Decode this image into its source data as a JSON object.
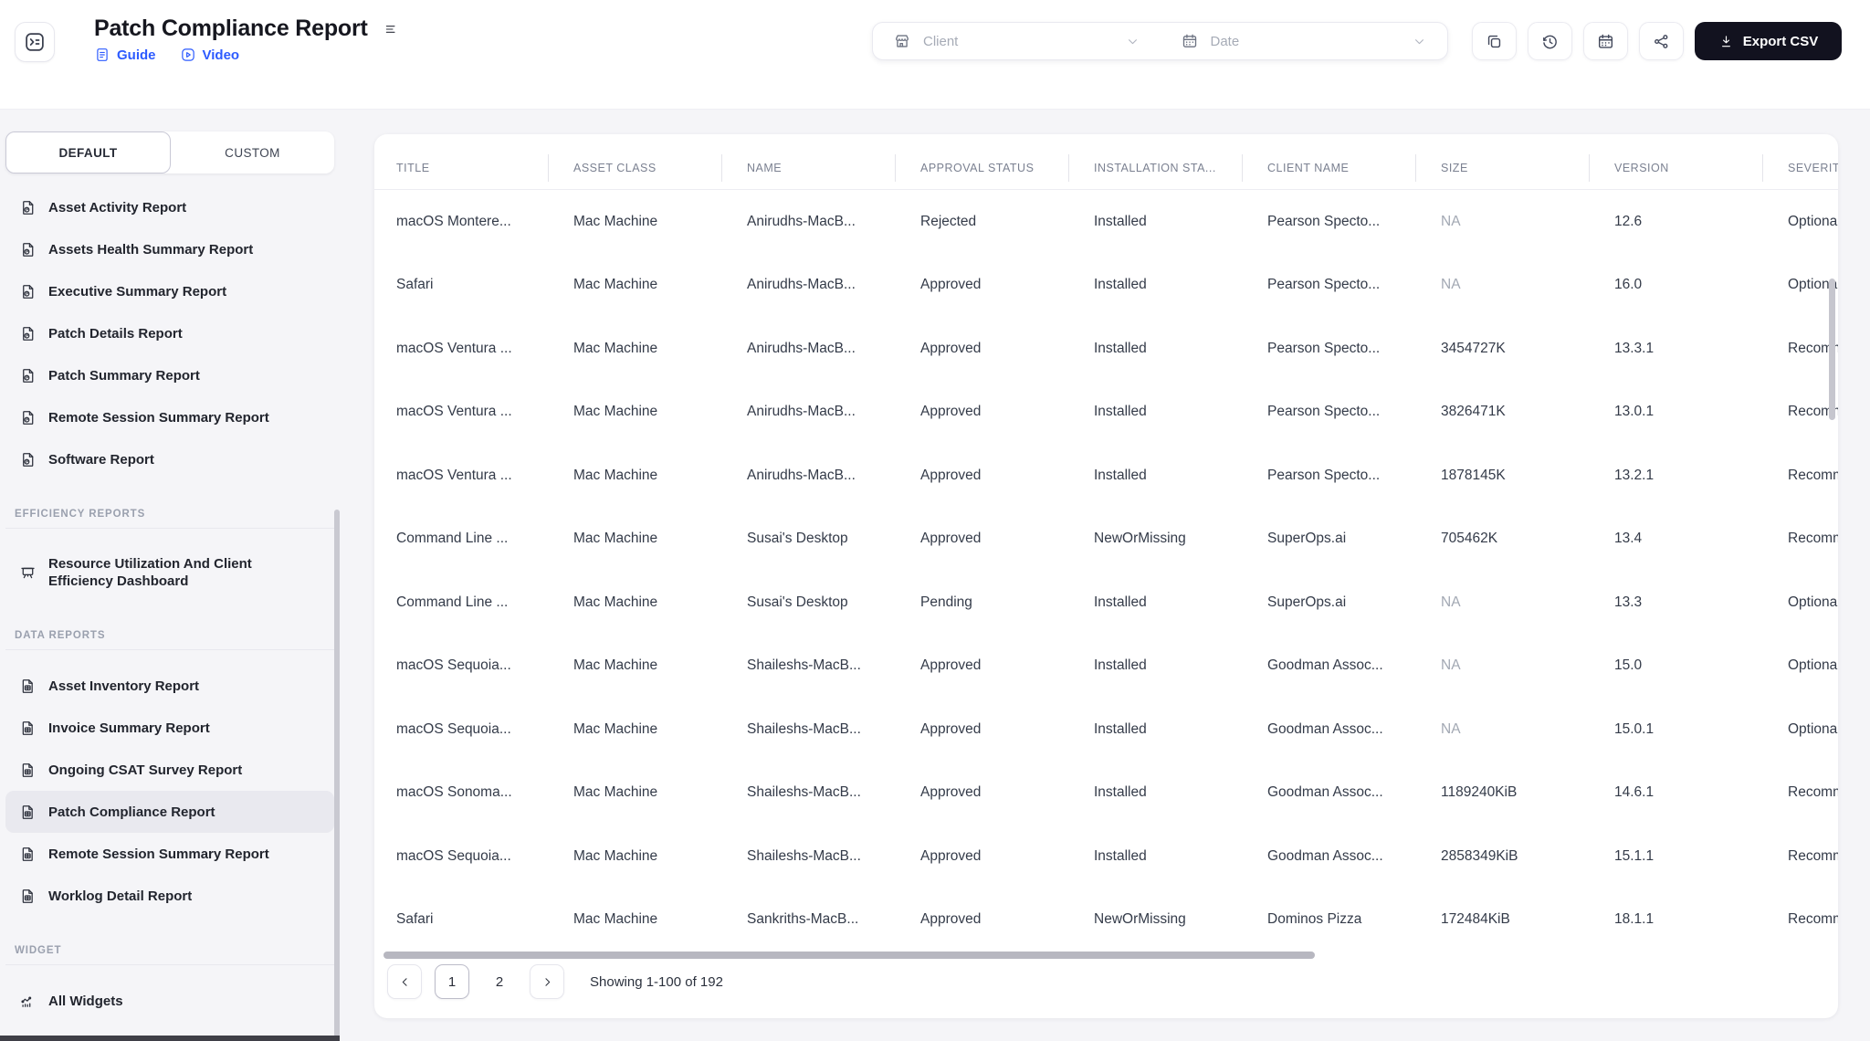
{
  "header": {
    "title": "Patch Compliance Report",
    "guide_label": "Guide",
    "video_label": "Video",
    "client_placeholder": "Client",
    "date_placeholder": "Date",
    "export_label": "Export CSV"
  },
  "sidebar": {
    "tabs": [
      {
        "label": "DEFAULT",
        "active": true
      },
      {
        "label": "CUSTOM",
        "active": false
      }
    ],
    "groups": [
      {
        "heading": "",
        "items": [
          {
            "label": "Asset Activity Report",
            "icon": "report-doc"
          },
          {
            "label": "Assets Health Summary Report",
            "icon": "report-doc"
          },
          {
            "label": "Executive Summary Report",
            "icon": "report-doc"
          },
          {
            "label": "Patch Details Report",
            "icon": "report-doc"
          },
          {
            "label": "Patch Summary Report",
            "icon": "report-doc"
          },
          {
            "label": "Remote Session Summary Report",
            "icon": "report-doc"
          },
          {
            "label": "Software Report",
            "icon": "report-doc"
          }
        ]
      },
      {
        "heading": "EFFICIENCY REPORTS",
        "items": [
          {
            "label": "Resource Utilization And Client Efficiency Dashboard",
            "icon": "dashboard",
            "two_line": true
          }
        ]
      },
      {
        "heading": "DATA REPORTS",
        "items": [
          {
            "label": "Asset Inventory Report",
            "icon": "data-doc"
          },
          {
            "label": "Invoice Summary Report",
            "icon": "data-doc"
          },
          {
            "label": "Ongoing CSAT Survey Report",
            "icon": "data-doc"
          },
          {
            "label": "Patch Compliance Report",
            "icon": "data-doc",
            "active": true
          },
          {
            "label": "Remote Session Summary Report",
            "icon": "data-doc"
          },
          {
            "label": "Worklog Detail Report",
            "icon": "data-doc"
          }
        ]
      },
      {
        "heading": "WIDGET",
        "items": [
          {
            "label": "All Widgets",
            "icon": "widgets"
          }
        ]
      }
    ]
  },
  "table": {
    "columns": [
      "TITLE",
      "ASSET CLASS",
      "NAME",
      "APPROVAL STATUS",
      "INSTALLATION STA...",
      "CLIENT NAME",
      "SIZE",
      "VERSION",
      "SEVERITY"
    ],
    "muted_value": "NA",
    "rows": [
      [
        "macOS Montere...",
        "Mac Machine",
        "Anirudhs-MacB...",
        "Rejected",
        "Installed",
        "Pearson Specto...",
        "NA",
        "12.6",
        "Optional"
      ],
      [
        "Safari",
        "Mac Machine",
        "Anirudhs-MacB...",
        "Approved",
        "Installed",
        "Pearson Specto...",
        "NA",
        "16.0",
        "Optional"
      ],
      [
        "macOS Ventura ...",
        "Mac Machine",
        "Anirudhs-MacB...",
        "Approved",
        "Installed",
        "Pearson Specto...",
        "3454727K",
        "13.3.1",
        "Recommended"
      ],
      [
        "macOS Ventura ...",
        "Mac Machine",
        "Anirudhs-MacB...",
        "Approved",
        "Installed",
        "Pearson Specto...",
        "3826471K",
        "13.0.1",
        "Recommended"
      ],
      [
        "macOS Ventura ...",
        "Mac Machine",
        "Anirudhs-MacB...",
        "Approved",
        "Installed",
        "Pearson Specto...",
        "1878145K",
        "13.2.1",
        "Recommended"
      ],
      [
        "Command Line ...",
        "Mac Machine",
        "Susai's Desktop",
        "Approved",
        "NewOrMissing",
        "SuperOps.ai",
        "705462K",
        "13.4",
        "Recommended"
      ],
      [
        "Command Line ...",
        "Mac Machine",
        "Susai's Desktop",
        "Pending",
        "Installed",
        "SuperOps.ai",
        "NA",
        "13.3",
        "Optional"
      ],
      [
        "macOS Sequoia...",
        "Mac Machine",
        "Shaileshs-MacB...",
        "Approved",
        "Installed",
        "Goodman Assoc...",
        "NA",
        "15.0",
        "Optional"
      ],
      [
        "macOS Sequoia...",
        "Mac Machine",
        "Shaileshs-MacB...",
        "Approved",
        "Installed",
        "Goodman Assoc...",
        "NA",
        "15.0.1",
        "Optional"
      ],
      [
        "macOS Sonoma...",
        "Mac Machine",
        "Shaileshs-MacB...",
        "Approved",
        "Installed",
        "Goodman Assoc...",
        "1189240KiB",
        "14.6.1",
        "Recommended"
      ],
      [
        "macOS Sequoia...",
        "Mac Machine",
        "Shaileshs-MacB...",
        "Approved",
        "Installed",
        "Goodman Assoc...",
        "2858349KiB",
        "15.1.1",
        "Recommended"
      ],
      [
        "Safari",
        "Mac Machine",
        "Sankriths-MacB...",
        "Approved",
        "NewOrMissing",
        "Dominos Pizza",
        "172484KiB",
        "18.1.1",
        "Recommended"
      ]
    ]
  },
  "pagination": {
    "pages": [
      "1",
      "2"
    ],
    "current": "1",
    "summary": "Showing 1-100 of 192"
  },
  "colors": {
    "accent_blue": "#2d5bff",
    "export_button_bg": "#12121f",
    "selected_item_bg": "#e9e9ef"
  }
}
